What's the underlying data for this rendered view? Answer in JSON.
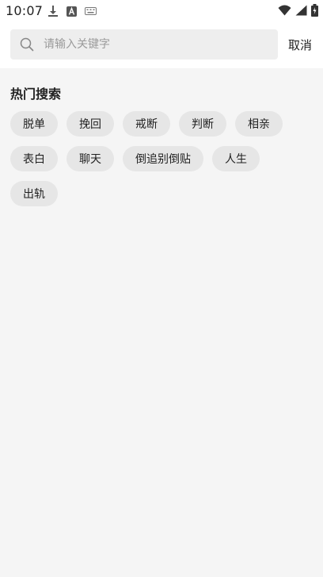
{
  "status_bar": {
    "time": "10:07",
    "left_icons": [
      "download-icon",
      "a-badge-icon",
      "keyboard-icon"
    ],
    "right_icons": [
      "wifi-icon",
      "signal-icon",
      "battery-icon"
    ]
  },
  "search": {
    "placeholder": "请输入关键字",
    "value": "",
    "cancel_label": "取消"
  },
  "hot_search": {
    "title": "热门搜索",
    "rows": [
      [
        "脱单",
        "挽回",
        "戒断",
        "判断",
        "相亲"
      ],
      [
        "表白",
        "聊天",
        "倒追别倒贴",
        "人生"
      ],
      [
        "出轨"
      ]
    ]
  },
  "colors": {
    "page_bg": "#f5f5f5",
    "header_bg": "#ffffff",
    "search_bg": "#eeeeee",
    "tag_bg": "#e6e6e6"
  }
}
